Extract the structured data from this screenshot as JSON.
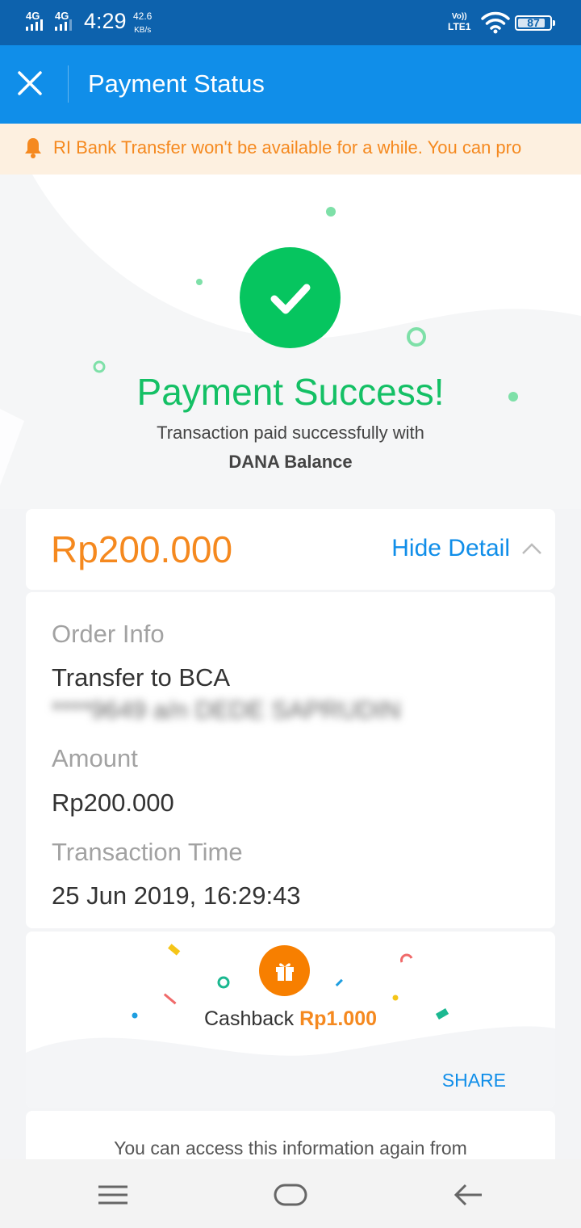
{
  "status_bar": {
    "network_1": "4G",
    "network_2": "4G",
    "time": "4:29",
    "speed_value": "42.6",
    "speed_unit": "KB/s",
    "volte_top": "Vo))",
    "volte_bottom": "LTE1",
    "battery": "87",
    "battery_level_percent": 87
  },
  "app_bar": {
    "title": "Payment Status",
    "close_icon": "close-icon"
  },
  "notice": {
    "icon": "bell-icon",
    "text": "RI Bank Transfer won't be available for a while. You can pro"
  },
  "hero": {
    "title": "Payment Success!",
    "subtitle": "Transaction paid successfully with",
    "method": "DANA Balance"
  },
  "amount_card": {
    "amount": "Rp200.000",
    "toggle_label": "Hide Detail"
  },
  "details": {
    "order_info_label": "Order Info",
    "order_info_value": "Transfer to BCA",
    "order_info_redacted": "****9649 a/n DEDE SAPRUDIN",
    "amount_label": "Amount",
    "amount_value": "Rp200.000",
    "time_label": "Transaction Time",
    "time_value": "25 Jun 2019, 16:29:43"
  },
  "cashback": {
    "label": "Cashback",
    "amount": "Rp1.000",
    "share_label": "SHARE"
  },
  "info": {
    "text": "You can access this information again from"
  },
  "colors": {
    "status_bar": "#0d62ad",
    "app_bar": "#108ee9",
    "success_green": "#14c065",
    "amount_orange": "#f5891f",
    "link_blue": "#108ee9",
    "notice_bg": "#fdf0e0"
  }
}
